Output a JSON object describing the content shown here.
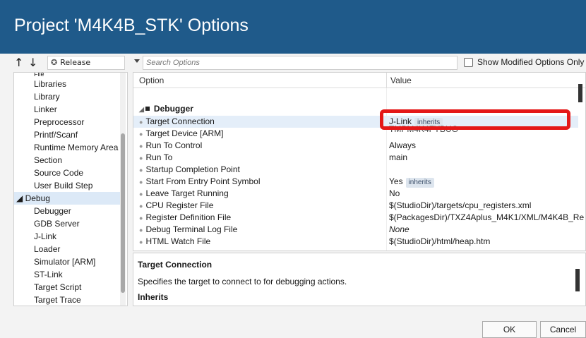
{
  "window": {
    "title": "Project 'M4K4B_STK' Options"
  },
  "toolbar": {
    "up_glyph": "↑",
    "down_glyph": "↓",
    "configuration": "Release",
    "configuration_glyph": "✪",
    "search_placeholder": "Search Options",
    "show_modified_label": "Show Modified Options Only"
  },
  "tree": {
    "items": [
      {
        "label": "Libraries",
        "level": 1
      },
      {
        "label": "Library",
        "level": 1
      },
      {
        "label": "Linker",
        "level": 1
      },
      {
        "label": "Preprocessor",
        "level": 1
      },
      {
        "label": "Printf/Scanf",
        "level": 1
      },
      {
        "label": "Runtime Memory Area",
        "level": 1
      },
      {
        "label": "Section",
        "level": 1
      },
      {
        "label": "Source Code",
        "level": 1
      },
      {
        "label": "User Build Step",
        "level": 1
      },
      {
        "label": "◢ Debug",
        "level": 0
      },
      {
        "label": "Debugger",
        "level": 1
      },
      {
        "label": "GDB Server",
        "level": 1
      },
      {
        "label": "J-Link",
        "level": 1
      },
      {
        "label": "Loader",
        "level": 1
      },
      {
        "label": "Simulator [ARM]",
        "level": 1
      },
      {
        "label": "ST-Link",
        "level": 1
      },
      {
        "label": "Target Script",
        "level": 1
      },
      {
        "label": "Target Trace",
        "level": 1
      }
    ]
  },
  "grid": {
    "col_option": "Option",
    "col_value": "Value",
    "group": "Debugger",
    "rows": [
      {
        "option": "Target Connection",
        "value": "J-Link",
        "badge": "inherits",
        "italic": false
      },
      {
        "option": "Target Device [ARM]",
        "value": "",
        "badge": "",
        "italic": false
      },
      {
        "option": "Run To Control",
        "value": "Always",
        "badge": "",
        "italic": false
      },
      {
        "option": "Run To",
        "value": "main",
        "badge": "",
        "italic": false
      },
      {
        "option": "Startup Completion Point",
        "value": "",
        "badge": "",
        "italic": false
      },
      {
        "option": "Start From Entry Point Symbol",
        "value": "Yes",
        "badge": "inherits",
        "italic": false
      },
      {
        "option": "Leave Target Running",
        "value": "No",
        "badge": "",
        "italic": false
      },
      {
        "option": "CPU Register File",
        "value": "$(StudioDir)/targets/cpu_registers.xml",
        "badge": "",
        "italic": false
      },
      {
        "option": "Register Definition File",
        "value": "$(PackagesDir)/TXZ4Aplus_M4K1/XML/M4K4B_Re",
        "badge": "",
        "italic": false
      },
      {
        "option": "Debug Terminal Log File",
        "value": "None",
        "badge": "",
        "italic": true
      },
      {
        "option": "HTML Watch File",
        "value": "$(StudioDir)/html/heap.htm",
        "badge": "",
        "italic": false
      }
    ],
    "partial_value": "TMPM4K4FYBUG"
  },
  "description": {
    "title": "Target Connection",
    "text": "Specifies the target to connect to for debugging actions.",
    "inherits_heading": "Inherits"
  },
  "buttons": {
    "ok": "OK",
    "cancel": "Cancel"
  },
  "colors": {
    "titlebar": "#1f5a8a",
    "highlight": "#e41818"
  }
}
